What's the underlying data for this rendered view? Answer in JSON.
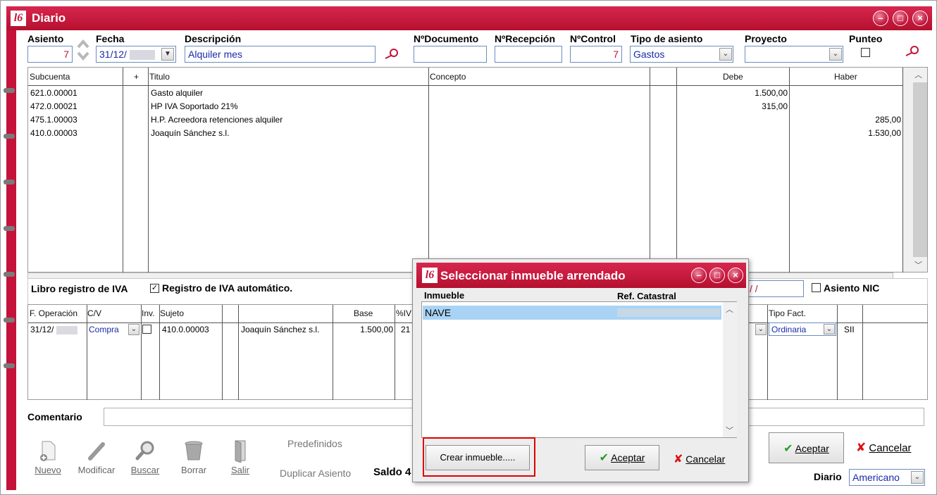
{
  "window": {
    "title": "Diario",
    "logo": "l6"
  },
  "header": {
    "asiento_label": "Asiento",
    "asiento_value": "7",
    "fecha_label": "Fecha",
    "fecha_value": "31/12/",
    "descripcion_label": "Descripción",
    "descripcion_value": "Alquiler mes",
    "ndocumento_label": "NºDocumento",
    "ndocumento_value": "",
    "nrecepcion_label": "NºRecepción",
    "nrecepcion_value": "",
    "ncontrol_label": "NºControl",
    "ncontrol_value": "7",
    "tipo_label": "Tipo de asiento",
    "tipo_value": "Gastos",
    "proyecto_label": "Proyecto",
    "proyecto_value": "",
    "punteo_label": "Punteo"
  },
  "entries": {
    "columns": [
      "Subcuenta",
      "+",
      "Titulo",
      "Concepto",
      "",
      "Debe",
      "Haber"
    ],
    "rows": [
      {
        "subcuenta": "621.0.00001",
        "titulo": "Gasto alquiler",
        "concepto": "",
        "debe": "1.500,00",
        "haber": ""
      },
      {
        "subcuenta": "472.0.00021",
        "titulo": "HP IVA Soportado 21%",
        "concepto": "",
        "debe": "315,00",
        "haber": ""
      },
      {
        "subcuenta": "475.1.00003",
        "titulo": "H.P. Acreedora retenciones alquiler",
        "concepto": "",
        "debe": "",
        "haber": "285,00"
      },
      {
        "subcuenta": "410.0.00003",
        "titulo": "Joaquín Sánchez s.l.",
        "concepto": "",
        "debe": "",
        "haber": "1.530,00"
      }
    ]
  },
  "iva": {
    "section_label": "Libro registro de IVA",
    "auto_label": "Registro de IVA automático.",
    "auto_checked": true,
    "date_field": "/  /",
    "nic_label": "Asiento NIC",
    "columns": {
      "f_operacion": "F. Operación",
      "cv": "C/V",
      "inv": "Inv.",
      "sujeto": "Sujeto",
      "base": "Base",
      "piva": "%IV",
      "tipo_fact": "Tipo Fact."
    },
    "row": {
      "f_operacion": "31/12/",
      "cv": "Compra",
      "sujeto": "410.0.00003",
      "nombre": "Joaquín Sánchez s.l.",
      "base": "1.500,00",
      "piva": "21",
      "tipo_fact": "Ordinaria",
      "sii": "SII"
    }
  },
  "comentario_label": "Comentario",
  "toolbar": {
    "nuevo": "Nuevo",
    "modificar": "Modificar",
    "buscar": "Buscar",
    "borrar": "Borrar",
    "salir": "Salir",
    "predefinidos": "Predefinidos",
    "duplicar": "Duplicar Asiento",
    "saldo": "Saldo 4"
  },
  "footer": {
    "aceptar": "Aceptar",
    "cancelar": "Cancelar",
    "diario_label": "Diario",
    "diario_value": "Americano"
  },
  "dialog": {
    "title": "Seleccionar inmueble arrendado",
    "col_inmueble": "Inmueble",
    "col_ref": "Ref. Catastral",
    "items": [
      {
        "inmueble": "NAVE",
        "ref": ""
      }
    ],
    "crear": "Crear inmueble.....",
    "aceptar": "Aceptar",
    "cancelar": "Cancelar"
  },
  "colors": {
    "brand": "#c4123a",
    "selection": "#a9d3f5",
    "highlight_box": "#e00000"
  }
}
